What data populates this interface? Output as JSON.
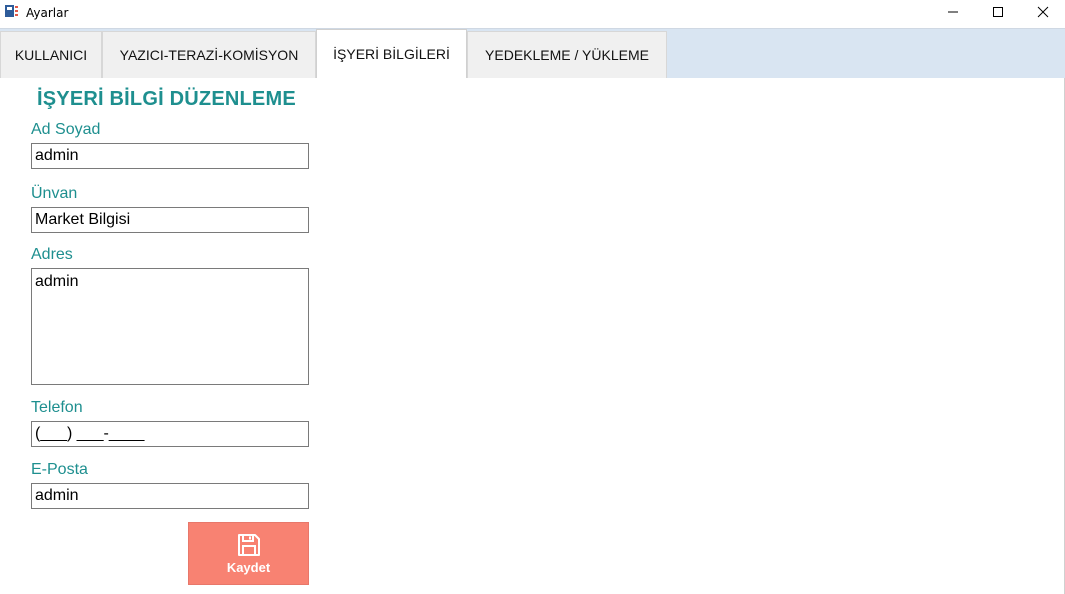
{
  "window": {
    "title": "Ayarlar"
  },
  "tabs": [
    {
      "label": "KULLANICI",
      "active": false
    },
    {
      "label": "YAZICI-TERAZİ-KOMİSYON",
      "active": false
    },
    {
      "label": "İŞYERİ BİLGİLERİ",
      "active": true
    },
    {
      "label": "YEDEKLEME / YÜKLEME",
      "active": false
    }
  ],
  "form": {
    "heading": "İŞYERİ BİLGİ DÜZENLEME",
    "name": {
      "label": "Ad Soyad",
      "value": "admin"
    },
    "title": {
      "label": "Ünvan",
      "value": "Market Bilgisi"
    },
    "address": {
      "label": "Adres",
      "value": "admin"
    },
    "phone": {
      "label": "Telefon",
      "value": "(___) ___-____"
    },
    "email": {
      "label": "E-Posta",
      "value": "admin"
    },
    "save_label": "Kaydet"
  },
  "icons": {
    "app": "app-icon",
    "minimize": "minimize-icon",
    "maximize": "maximize-icon",
    "close": "close-icon",
    "save": "floppy-disk-icon"
  },
  "colors": {
    "accent": "#1e8f8f",
    "tabstrip": "#d9e5f2",
    "save_button": "#f88272"
  }
}
